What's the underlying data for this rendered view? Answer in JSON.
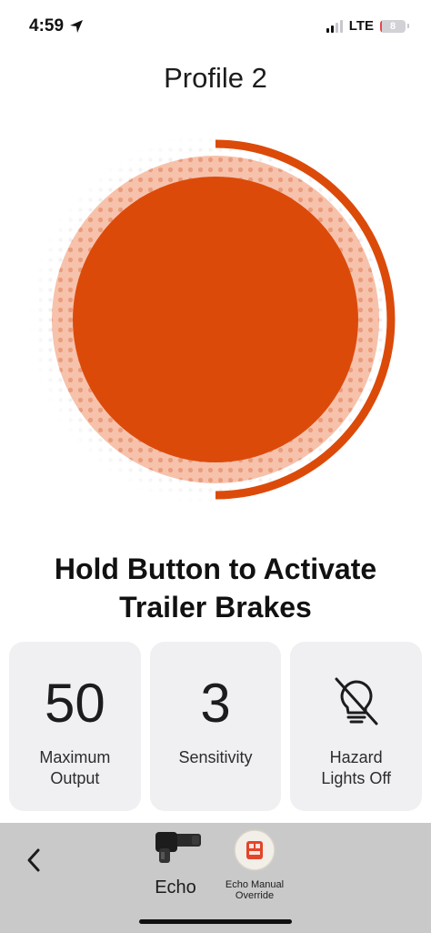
{
  "status_bar": {
    "time": "4:59",
    "network": "LTE",
    "battery_level": "8",
    "battery_fraction": 0.08,
    "signal_bars_active": 2,
    "signal_bars_total": 4
  },
  "page": {
    "title": "Profile 2"
  },
  "brake_button": {
    "instruction": "Hold Button to Activate Trailer Brakes",
    "accent_color": "#dc4a0a",
    "halo_color": "#f6c2ac",
    "dot_color": "#d9d9d9",
    "level_arc_fraction": 0.5
  },
  "settings": [
    {
      "value": "50",
      "label": "Maximum\nOutput"
    },
    {
      "value": "3",
      "label": "Sensitivity"
    },
    {
      "icon": "hazard-lights-off-icon",
      "label": "Hazard\nLights Off"
    }
  ],
  "bottom_bar": {
    "back_icon": "chevron-left-icon",
    "devices": [
      {
        "label": "Echo",
        "icon": "echo-device-icon"
      },
      {
        "label": "Echo Manual Override",
        "icon": "manual-override-icon"
      }
    ],
    "background": "#c9c9c9"
  }
}
